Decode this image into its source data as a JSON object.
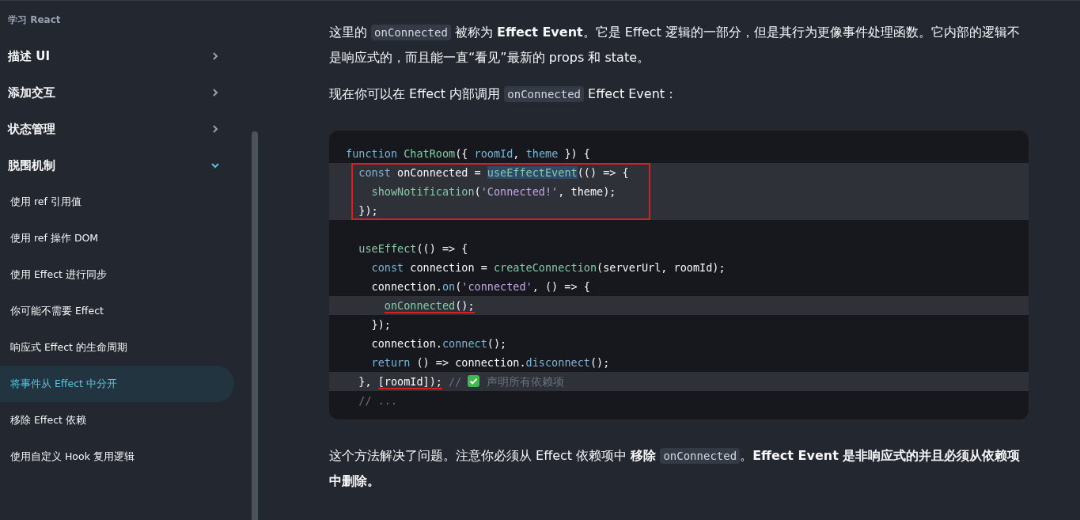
{
  "sidebar": {
    "heading": "学习 React",
    "sections": [
      {
        "label": "描述 UI",
        "expanded": false
      },
      {
        "label": "添加交互",
        "expanded": false
      },
      {
        "label": "状态管理",
        "expanded": false
      },
      {
        "label": "脱围机制",
        "expanded": true,
        "children": [
          {
            "label": "使用 ref 引用值",
            "selected": false
          },
          {
            "label": "使用 ref 操作 DOM",
            "selected": false
          },
          {
            "label": "使用 Effect 进行同步",
            "selected": false
          },
          {
            "label": "你可能不需要 Effect",
            "selected": false
          },
          {
            "label": "响应式 Effect 的生命周期",
            "selected": false
          },
          {
            "label": "将事件从 Effect 中分开",
            "selected": true
          },
          {
            "label": "移除 Effect 依赖",
            "selected": false
          },
          {
            "label": "使用自定义 Hook 复用逻辑",
            "selected": false
          }
        ]
      }
    ]
  },
  "content": [
    {
      "kind": "paragraph",
      "segments": [
        {
          "kind": "text",
          "text": "这里的 "
        },
        {
          "kind": "code",
          "text": "onConnected"
        },
        {
          "kind": "text",
          "text": " 被称为 **Effect Event**。它是 Effect 逻辑的一部分，但是其行为更像事件处理函数。它内部的逻辑不是响应式的，而且能一直“看见”最新的 props 和 state。"
        }
      ]
    },
    {
      "kind": "paragraph",
      "segments": [
        {
          "kind": "text",
          "text": "现在你可以在 Effect 内部调用 "
        },
        {
          "kind": "code",
          "text": "onConnected"
        },
        {
          "kind": "text",
          "text": " Effect Event："
        }
      ]
    },
    {
      "kind": "code_block",
      "lines": [
        {
          "highlighted": false,
          "boxed": false,
          "tokens": [
            {
              "kind": "keyword",
              "text": "function "
            },
            {
              "kind": "function",
              "text": "ChatRoom"
            },
            {
              "kind": "plain",
              "text": "({ "
            },
            {
              "kind": "param",
              "text": "roomId"
            },
            {
              "kind": "plain",
              "text": ", "
            },
            {
              "kind": "param",
              "text": "theme"
            },
            {
              "kind": "plain",
              "text": " }) {"
            }
          ]
        },
        {
          "highlighted": true,
          "boxed": true,
          "tokens": [
            {
              "kind": "keyword",
              "text": "  const"
            },
            {
              "kind": "plain",
              "text": " onConnected = "
            },
            {
              "kind": "function",
              "text": "useEffectEvent",
              "selected": true
            },
            {
              "kind": "plain",
              "text": "(() => {"
            }
          ]
        },
        {
          "highlighted": true,
          "boxed": true,
          "tokens": [
            {
              "kind": "function",
              "text": "    showNotification"
            },
            {
              "kind": "plain",
              "text": "("
            },
            {
              "kind": "string",
              "text": "'Connected!'"
            },
            {
              "kind": "plain",
              "text": ", theme);"
            }
          ]
        },
        {
          "highlighted": true,
          "boxed": true,
          "tokens": [
            {
              "kind": "plain",
              "text": "  });"
            }
          ]
        },
        {
          "highlighted": false,
          "boxed": false
        },
        {
          "highlighted": false,
          "boxed": false,
          "tokens": [
            {
              "kind": "function",
              "text": "  useEffect"
            },
            {
              "kind": "plain",
              "text": "(() => {"
            }
          ]
        },
        {
          "highlighted": false,
          "boxed": false,
          "tokens": [
            {
              "kind": "keyword",
              "text": "    const"
            },
            {
              "kind": "plain",
              "text": " connection = "
            },
            {
              "kind": "function",
              "text": "createConnection"
            },
            {
              "kind": "plain",
              "text": "(serverUrl, roomId);"
            }
          ]
        },
        {
          "highlighted": false,
          "boxed": false,
          "tokens": [
            {
              "kind": "plain",
              "text": "    connection."
            },
            {
              "kind": "method",
              "text": "on"
            },
            {
              "kind": "plain",
              "text": "("
            },
            {
              "kind": "string",
              "text": "'connected'"
            },
            {
              "kind": "plain",
              "text": ", () => {"
            }
          ]
        },
        {
          "highlighted": true,
          "boxed": false,
          "tokens": [
            {
              "kind": "function",
              "text": "      onConnected",
              "underlined": true
            },
            {
              "kind": "plain",
              "text": "();",
              "underlined": true
            }
          ]
        },
        {
          "highlighted": false,
          "boxed": false,
          "tokens": [
            {
              "kind": "plain",
              "text": "    });"
            }
          ]
        },
        {
          "highlighted": false,
          "boxed": false,
          "tokens": [
            {
              "kind": "plain",
              "text": "    connection."
            },
            {
              "kind": "method",
              "text": "connect"
            },
            {
              "kind": "plain",
              "text": "();"
            }
          ]
        },
        {
          "highlighted": false,
          "boxed": false,
          "tokens": [
            {
              "kind": "keyword",
              "text": "    return"
            },
            {
              "kind": "plain",
              "text": " () => connection."
            },
            {
              "kind": "method",
              "text": "disconnect"
            },
            {
              "kind": "plain",
              "text": "();"
            }
          ]
        },
        {
          "highlighted": true,
          "boxed": false,
          "tokens": [
            {
              "kind": "plain",
              "text": "  }, "
            },
            {
              "kind": "plain",
              "text": "[roomId]);",
              "underlined": true
            },
            {
              "kind": "comment",
              "text": " // "
            },
            {
              "kind": "icon"
            },
            {
              "kind": "comment",
              "text": " 声明所有依赖项"
            }
          ]
        },
        {
          "highlighted": false,
          "boxed": false,
          "tokens": [
            {
              "kind": "comment",
              "text": "  // ..."
            }
          ]
        }
      ]
    },
    {
      "kind": "paragraph",
      "segments": [
        {
          "kind": "text",
          "text": "这个方法解决了问题。注意你必须从 Effect 依赖项中 **移除** "
        },
        {
          "kind": "code",
          "text": "onConnected"
        },
        {
          "kind": "text",
          "text": "。**Effect Event 是非响应式的并且必须从依赖项中删除。**"
        }
      ]
    }
  ]
}
